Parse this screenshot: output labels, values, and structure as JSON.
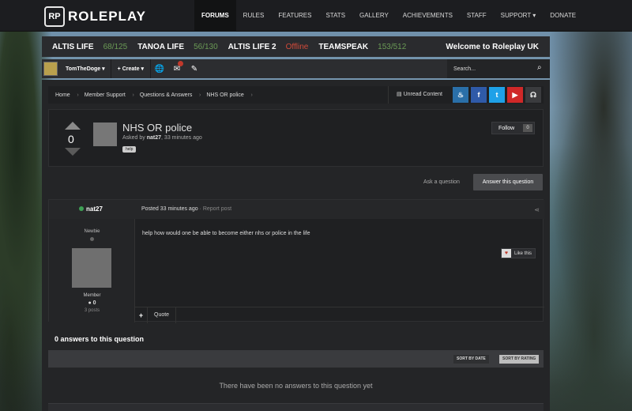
{
  "brand": {
    "mark": "RP",
    "name": "ROLEPLAY"
  },
  "nav": {
    "items": [
      {
        "label": "FORUMS"
      },
      {
        "label": "RULES"
      },
      {
        "label": "FEATURES"
      },
      {
        "label": "STATS"
      },
      {
        "label": "GALLERY"
      },
      {
        "label": "ACHIEVEMENTS"
      },
      {
        "label": "STAFF"
      },
      {
        "label": "SUPPORT ▾"
      },
      {
        "label": "DONATE"
      }
    ]
  },
  "servers": {
    "items": [
      {
        "name": "ALTIS LIFE",
        "status": "68/125"
      },
      {
        "name": "TANOA LIFE",
        "status": "56/130"
      },
      {
        "name": "ALTIS LIFE 2",
        "status": "Offline"
      },
      {
        "name": "TEAMSPEAK",
        "status": "153/512"
      }
    ],
    "welcome": "Welcome to Roleplay UK"
  },
  "userbar": {
    "username": "TomTheDoge ▾",
    "create": "+ Create ▾",
    "search_placeholder": "Search...",
    "icons": [
      "globe-icon",
      "inbox-icon",
      "brush-icon"
    ]
  },
  "breadcrumb": [
    "Home",
    "Member Support",
    "Questions & Answers",
    "NHS OR police"
  ],
  "unread_label": "Unread Content",
  "social": [
    {
      "name": "steam-icon",
      "glyph": "♨",
      "color": "#2a6fa8"
    },
    {
      "name": "facebook-icon",
      "glyph": "f",
      "color": "#2f5aa8"
    },
    {
      "name": "twitter-icon",
      "glyph": "t",
      "color": "#1ea1e8"
    },
    {
      "name": "youtube-icon",
      "glyph": "▶",
      "color": "#d02828"
    },
    {
      "name": "headset-icon",
      "glyph": "☊",
      "color": "#3a3b3e"
    }
  ],
  "question": {
    "votes": "0",
    "title": "NHS OR police",
    "asked_prefix": "Asked by ",
    "asked_user": "nat27",
    "asked_time": ", 33 minutes ago",
    "tag": "help",
    "follow_label": "Follow",
    "follow_count": "0"
  },
  "actions": {
    "ask": "Ask a question",
    "answer": "Answer this question"
  },
  "post": {
    "author": "nat27",
    "posted": "Posted 33 minutes ago",
    "report": " · Report post",
    "rank": "Newbie",
    "group": "Member",
    "reputation": "● 0",
    "posts": "3 posts",
    "body": "help how would one be able to become either nhs or police in the life",
    "like_label": "Like this",
    "quote_label": "Quote"
  },
  "answers": {
    "title": "0 answers to this question",
    "sort_date": "SORT BY DATE",
    "sort_rating": "SORT BY RATING",
    "empty": "There have been no answers to this question yet"
  }
}
